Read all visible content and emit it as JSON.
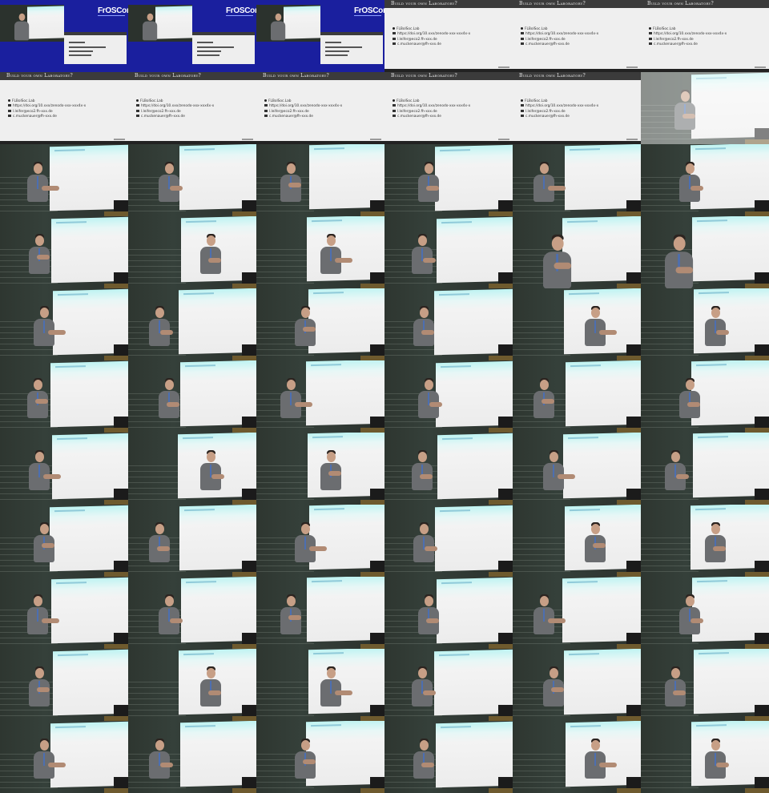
{
  "contact_sheet": {
    "conference_logo": "FrOSCon",
    "slide": {
      "title": "Build your own Laboratory?",
      "items": [
        "FLBolSoc.Lab",
        "https://doi.org/10.xxx/zenodo-xxx-xxx4x-x",
        "l.leifer@eco2.fh-xxx.de",
        "c.muckenauer@fh-xxx.de"
      ]
    },
    "screen_url": "opendatarvs.fh-xxx.de"
  }
}
